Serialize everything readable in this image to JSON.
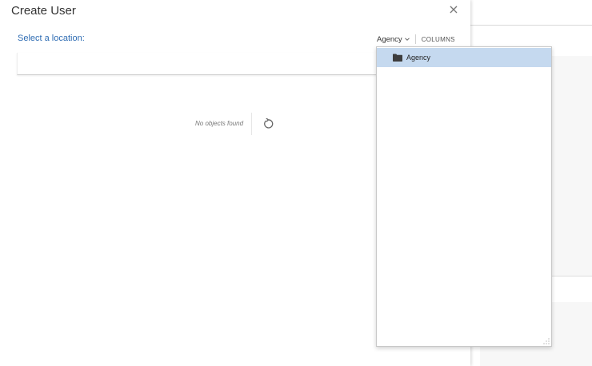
{
  "dialog": {
    "title": "Create User",
    "close_glyph": "×",
    "select_location_label": "Select a location:",
    "toolbar": {
      "agency_label": "Agency",
      "columns_label": "COLUMNS"
    },
    "empty_message": "No objects found"
  },
  "popup": {
    "items": [
      {
        "label": "Agency",
        "icon": "folder-icon",
        "selected": true
      }
    ]
  },
  "colors": {
    "accent_link": "#2e6cb3",
    "selected_row": "#c5d9ef"
  }
}
